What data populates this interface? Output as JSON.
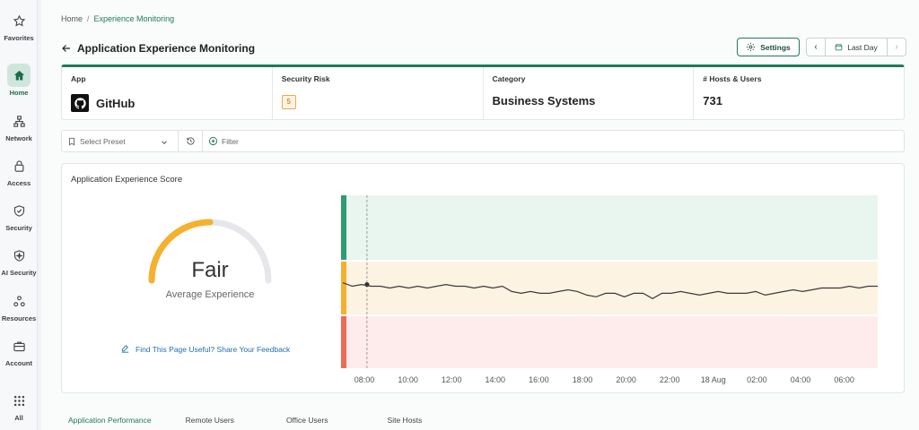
{
  "sidebar": {
    "items": [
      {
        "label": "Favorites",
        "icon": "star-icon"
      },
      {
        "label": "Home",
        "icon": "home-icon",
        "active": true
      },
      {
        "label": "Network",
        "icon": "network-icon"
      },
      {
        "label": "Access",
        "icon": "lock-icon"
      },
      {
        "label": "Security",
        "icon": "shield-icon"
      },
      {
        "label": "AI Security",
        "icon": "ai-shield-icon"
      },
      {
        "label": "Resources",
        "icon": "resources-icon"
      },
      {
        "label": "Account",
        "icon": "briefcase-icon"
      },
      {
        "label": "All",
        "icon": "grid-icon"
      }
    ]
  },
  "breadcrumb": {
    "home": "Home",
    "current": "Experience Monitoring"
  },
  "header": {
    "title": "Application Experience Monitoring",
    "settings_label": "Settings",
    "date_range": "Last Day"
  },
  "summary": {
    "app_label": "App",
    "app_value": "GitHub",
    "risk_label": "Security Risk",
    "risk_value": "5",
    "category_label": "Category",
    "category_value": "Business Systems",
    "hosts_label": "# Hosts & Users",
    "hosts_value": "731"
  },
  "filters": {
    "preset_placeholder": "Select Preset",
    "filter_label": "Filter"
  },
  "score": {
    "title": "Application Experience Score",
    "rating": "Fair",
    "rating_subtitle": "Average Experience",
    "feedback_link": "Find This Page Useful? Share Your Feedback"
  },
  "colors": {
    "accent": "#1f7a5a",
    "good": "#2e9b74",
    "fair": "#f5b02e",
    "poor": "#ef6a55",
    "link": "#1f6fb2"
  },
  "chart_data": {
    "type": "line",
    "x_ticks": [
      "08:00",
      "10:00",
      "12:00",
      "14:00",
      "16:00",
      "18:00",
      "20:00",
      "22:00",
      "18 Aug",
      "02:00",
      "04:00",
      "06:00"
    ],
    "bands": [
      "good",
      "fair",
      "poor"
    ],
    "series": [
      {
        "values": [
          58,
          56,
          57,
          56,
          56,
          55,
          56,
          55,
          56,
          55,
          56,
          57,
          56,
          56,
          55,
          56,
          55,
          56,
          53,
          52,
          53,
          52,
          52,
          53,
          54,
          53,
          51,
          50,
          52,
          52,
          50,
          52,
          52,
          49,
          52,
          52,
          53,
          52,
          51,
          52,
          53,
          52,
          52,
          52,
          53,
          51,
          52,
          53,
          54,
          53,
          54,
          55,
          55,
          55,
          56,
          55,
          56,
          56
        ]
      }
    ]
  }
}
